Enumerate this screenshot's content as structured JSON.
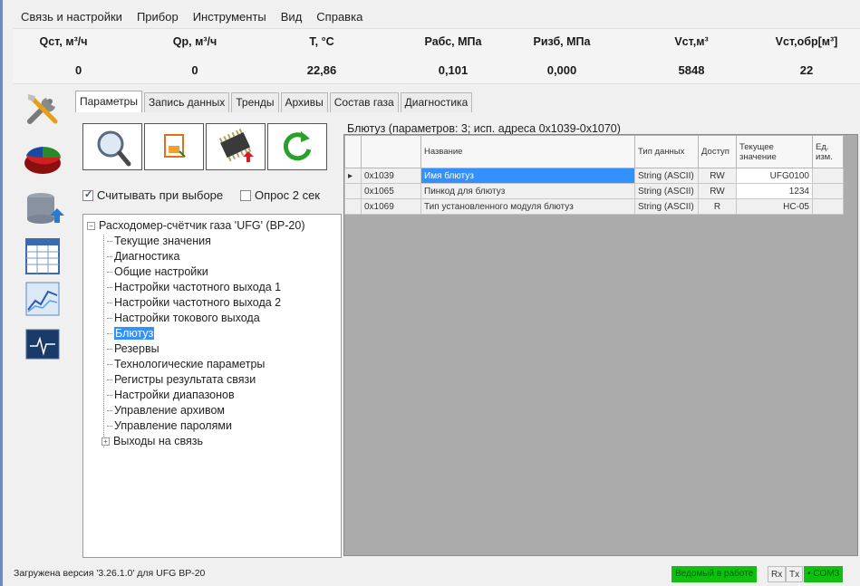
{
  "menu": [
    "Связь и настройки",
    "Прибор",
    "Инструменты",
    "Вид",
    "Справка"
  ],
  "readings": [
    {
      "label": "Qст, м³/ч",
      "value": "0"
    },
    {
      "label": "Qр, м³/ч",
      "value": "0"
    },
    {
      "label": "T, °C",
      "value": "22,86"
    },
    {
      "label": "Рабс, МПа",
      "value": "0,101"
    },
    {
      "label": "Ризб, МПа",
      "value": "0,000"
    },
    {
      "label": "Vст,м³",
      "value": "5848"
    },
    {
      "label": "Vст,обр[м³]",
      "value": "22"
    }
  ],
  "tabs": [
    "Параметры",
    "Запись данных",
    "Тренды",
    "Архивы",
    "Состав газа",
    "Диагностика"
  ],
  "toolbar_icons": [
    "search-icon",
    "save-icon",
    "chip-write-icon",
    "refresh-icon"
  ],
  "sidebar_icons": [
    "tools-icon",
    "pie-chart-icon",
    "database-icon",
    "table-icon",
    "trend-chart-icon",
    "pulse-monitor-icon"
  ],
  "checks": {
    "read_on_select": "Считывать при выборе",
    "poll_2s": "Опрос 2 сек"
  },
  "tree": {
    "root": "Расходомер-счётчик газа 'UFG' (BP-20)",
    "items": [
      "Текущие значения",
      "Диагностика",
      "Общие настройки",
      "Настройки частотного выхода 1",
      "Настройки частотного выхода 2",
      "Настройки токового выхода",
      "Блютуз",
      "Резервы",
      "Технологические параметры",
      "Регистры результата связи",
      "Настройки диапазонов",
      "Управление архивом",
      "Управление паролями"
    ],
    "collapsed_item": "Выходы на связь"
  },
  "grid": {
    "title": "Блютуз (параметров: 3; исп. адреса 0x1039-0x1070)",
    "headers": [
      "Название",
      "Тип данных",
      "Доступ",
      "Текущее значение",
      "Ед. изм."
    ],
    "rows": [
      {
        "addr": "0x1039",
        "name": "Имя блютуз",
        "type": "String (ASCII)",
        "access": "RW",
        "value": "UFG0100",
        "unit": ""
      },
      {
        "addr": "0x1065",
        "name": "Пинкод для блютуз",
        "type": "String (ASCII)",
        "access": "RW",
        "value": "1234",
        "unit": ""
      },
      {
        "addr": "0x1069",
        "name": "Тип установленного модуля блютуз",
        "type": "String (ASCII)",
        "access": "R",
        "value": "HC-05",
        "unit": ""
      }
    ]
  },
  "status": {
    "text": "Загружена версия '3.26.1.0' для UFG BP-20",
    "mode": "Ведомый в работе",
    "rx": "Rx",
    "tx": "Tx",
    "port": "COM3"
  }
}
